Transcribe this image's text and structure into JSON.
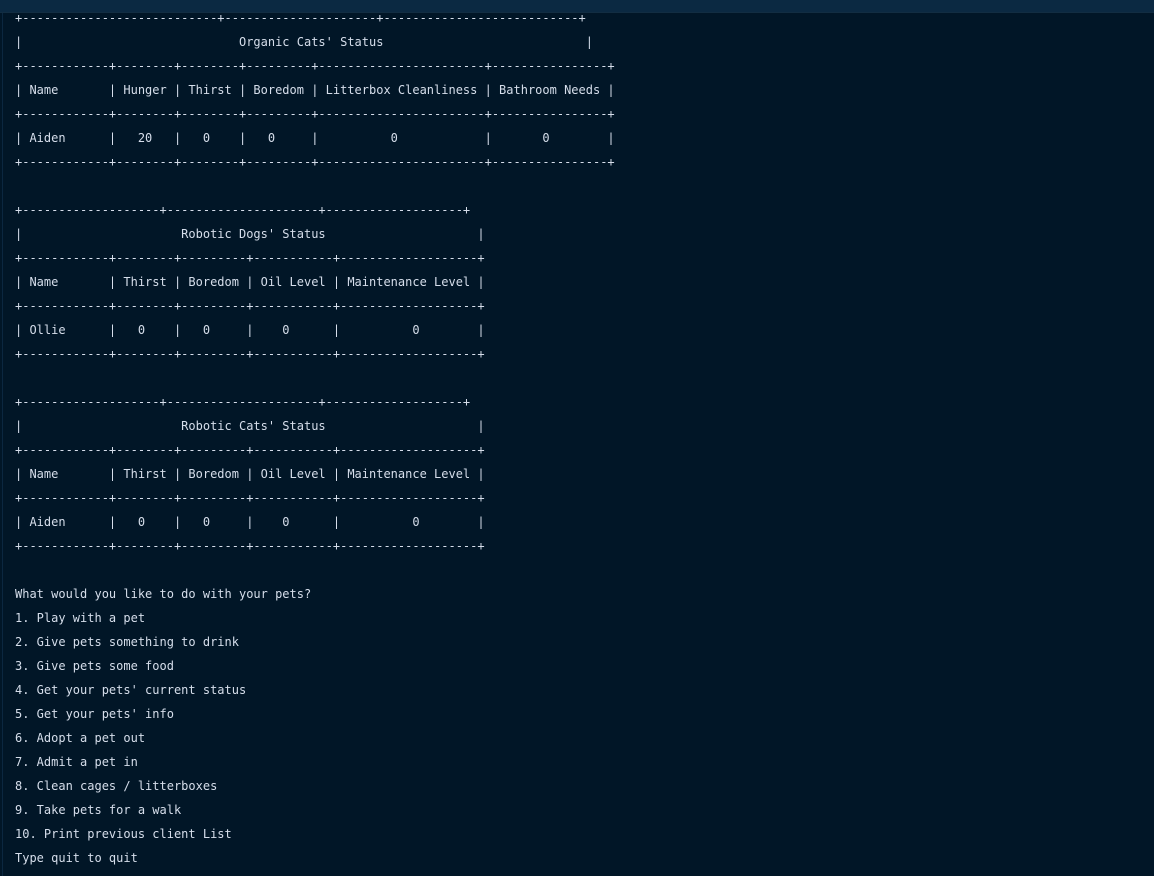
{
  "terminal": {
    "lines": [
      "+---------------------------+---------------------+---------------------------+",
      "|                              Organic Cats' Status                            |",
      "+------------+--------+--------+---------+-----------------------+----------------+",
      "| Name       | Hunger | Thirst | Boredom | Litterbox Cleanliness | Bathroom Needs |",
      "+------------+--------+--------+---------+-----------------------+----------------+",
      "| Aiden      |   20   |   0    |   0     |          0            |       0        |",
      "+------------+--------+--------+---------+-----------------------+----------------+",
      "",
      "+-------------------+---------------------+-------------------+",
      "|                      Robotic Dogs' Status                     |",
      "+------------+--------+---------+-----------+-------------------+",
      "| Name       | Thirst | Boredom | Oil Level | Maintenance Level |",
      "+------------+--------+---------+-----------+-------------------+",
      "| Ollie      |   0    |   0     |    0      |          0        |",
      "+------------+--------+---------+-----------+-------------------+",
      "",
      "+-------------------+---------------------+-------------------+",
      "|                      Robotic Cats' Status                     |",
      "+------------+--------+---------+-----------+-------------------+",
      "| Name       | Thirst | Boredom | Oil Level | Maintenance Level |",
      "+------------+--------+---------+-----------+-------------------+",
      "| Aiden      |   0    |   0     |    0      |          0        |",
      "+------------+--------+---------+-----------+-------------------+",
      "",
      "What would you like to do with your pets?",
      "1. Play with a pet",
      "2. Give pets something to drink",
      "3. Give pets some food",
      "4. Get your pets' current status",
      "5. Get your pets' info",
      "6. Adopt a pet out",
      "7. Admit a pet in",
      "8. Clean cages / litterboxes",
      "9. Take pets for a walk",
      "10. Print previous client List",
      "Type quit to quit"
    ]
  },
  "colors": {
    "background": "#011627",
    "text": "#d6deeb",
    "top_strip": "#0b2942"
  }
}
